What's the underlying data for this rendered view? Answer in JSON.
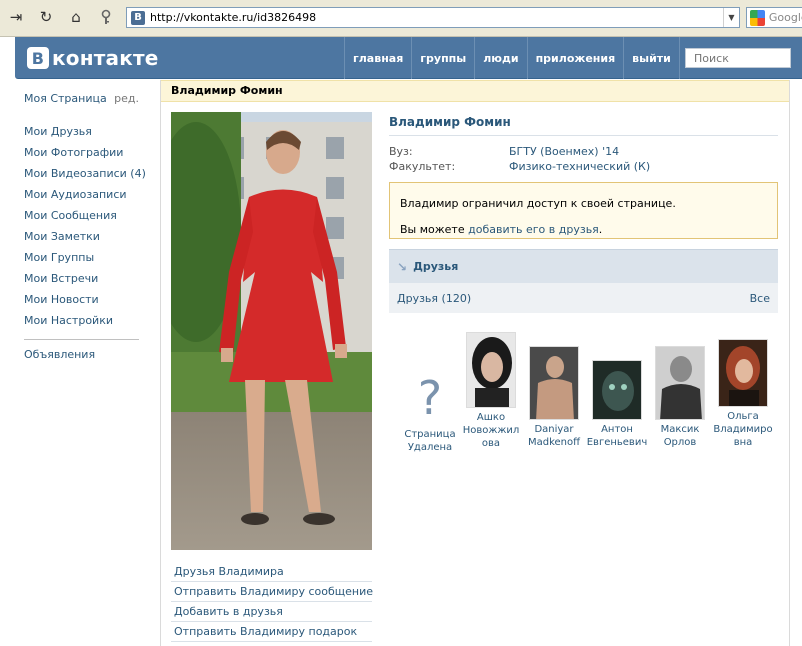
{
  "browser": {
    "url": "http://vkontakte.ru/id3826498",
    "favicon": "В",
    "search_placeholder": "Google",
    "nav_icons": [
      "forward-icon",
      "reload-icon",
      "home-icon",
      "key-icon"
    ]
  },
  "header": {
    "logo_text": "контакте",
    "logo_letter": "В",
    "nav": [
      "главная",
      "группы",
      "люди",
      "приложения",
      "выйти"
    ],
    "search_placeholder": "Поиск"
  },
  "sidebar": {
    "my_page": "Моя Страница",
    "edit": "ред.",
    "items": [
      "Мои Друзья",
      "Мои Фотографии",
      "Мои Видеозаписи (4)",
      "Мои Аудиозаписи",
      "Мои Сообщения",
      "Мои Заметки",
      "Мои Группы",
      "Мои Встречи",
      "Мои Новости",
      "Мои Настройки"
    ],
    "ads": "Объявления"
  },
  "profile": {
    "header_name": "Владимир Фомин",
    "name": "Владимир Фомин",
    "university_label": "Вуз:",
    "university_value": "БГТУ (Военмех) '14",
    "faculty_label": "Факультет:",
    "faculty_value": "Физико-технический (К)",
    "notice_line1": "Владимир ограничил доступ к своей странице.",
    "notice_line2_prefix": "Вы можете ",
    "notice_line2_link": "добавить его в друзья",
    "notice_line2_suffix": ".",
    "friends_title": "Друзья",
    "friends_count": "Друзья (120)",
    "friends_all": "Все",
    "actions": [
      "Друзья Владимира",
      "Отправить Владимиру сообщение",
      "Добавить в друзья",
      "Отправить Владимиру подарок"
    ],
    "friends": [
      {
        "name": "Страница Удалена",
        "deleted": true
      },
      {
        "name": "Ашко Новожжилова"
      },
      {
        "name": "Daniyar Madkenoff"
      },
      {
        "name": "Антон Евгеньевич"
      },
      {
        "name": "Максик Орлов"
      },
      {
        "name": "Ольга Владимировна"
      }
    ]
  },
  "colors": {
    "header": "#4d76a1",
    "link": "#2b587a",
    "name_bar": "#fcf5d8",
    "notice_border": "#e2c476"
  }
}
